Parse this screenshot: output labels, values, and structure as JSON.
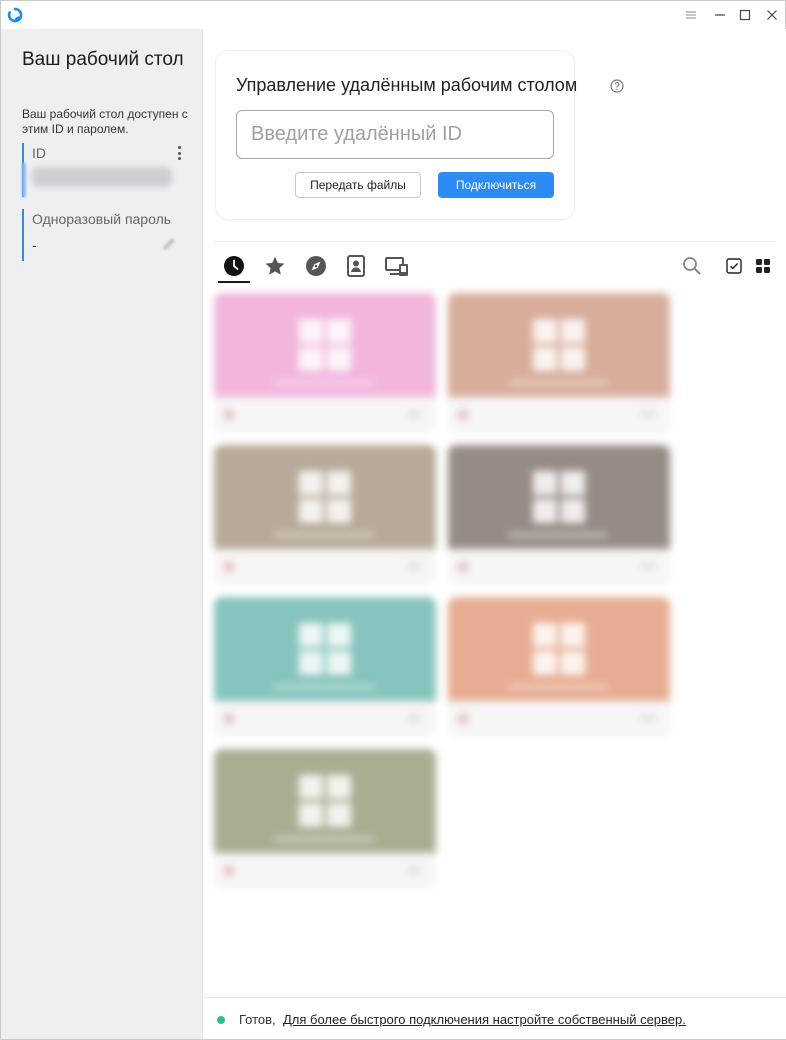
{
  "titlebar": {
    "icons": [
      "app-logo-icon",
      "menu-icon",
      "minimize-icon",
      "maximize-icon",
      "close-icon"
    ]
  },
  "sidebar": {
    "title": "Ваш рабочий стол",
    "description": "Ваш рабочий стол доступен с этим ID и паролем.",
    "id_label": "ID",
    "password_label": "Одноразовый пароль",
    "password_value": "-"
  },
  "remote": {
    "title": "Управление удалённым рабочим столом",
    "input_placeholder": "Введите удалённый ID",
    "send_files_label": "Передать файлы",
    "connect_label": "Подключиться",
    "accent": "#2c8cf4"
  },
  "tabs": [
    {
      "icon": "clock-icon"
    },
    {
      "icon": "star-icon"
    },
    {
      "icon": "compass-icon"
    },
    {
      "icon": "address-book-icon"
    },
    {
      "icon": "group-icon"
    }
  ],
  "peers": [
    {
      "color": "#f2b6dc"
    },
    {
      "color": "#d8ad9a"
    },
    {
      "color": "#b6aa98"
    },
    {
      "color": "#978b86"
    },
    {
      "color": "#86c4bd"
    },
    {
      "color": "#e7ad92"
    },
    {
      "color": "#a9ad92"
    }
  ],
  "status": {
    "prefix": "Готов,",
    "link": "Для более быстрого подключения настройте собственный сервер.",
    "dot_color": "#2fbf8f"
  }
}
